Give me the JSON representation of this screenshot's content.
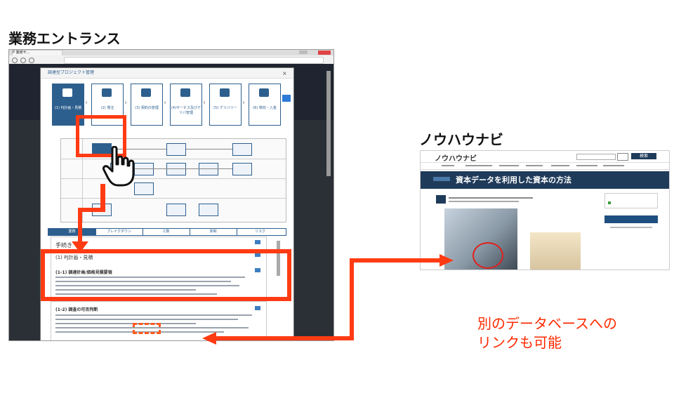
{
  "headings": {
    "left": "業務エントランス",
    "right": "ノウハウナビ"
  },
  "caption": {
    "line1": "別のデータベースへの",
    "line2": "リンクも可能"
  },
  "browser": {
    "tab_title": "P 業務サ..."
  },
  "modal": {
    "title": "調達型プロジェクト管理",
    "steps": [
      {
        "label": "(1) PJ計画・見積",
        "active": true
      },
      {
        "label": "(2) 発注"
      },
      {
        "label": "(3) 契約の管理"
      },
      {
        "label": "(4)サービス及びデリバ管理"
      },
      {
        "label": "(5) デリバリー"
      },
      {
        "label": "(6) 検収・入金"
      }
    ],
    "tabs": [
      "業務",
      "ブレイクダウン",
      "工数",
      "体制",
      "リスク"
    ],
    "section_heading": "手続き",
    "subsection": "(1) PJ計画・見積",
    "items": [
      {
        "title": "(1-1) 調達計画/価格見積要領"
      },
      {
        "title": "(1-2) 調査の可否判断"
      }
    ]
  },
  "knowhow": {
    "site_name": "ノウハウナビ",
    "search_button": "検索",
    "hero_title": "資本データを利用した資本の方法"
  }
}
